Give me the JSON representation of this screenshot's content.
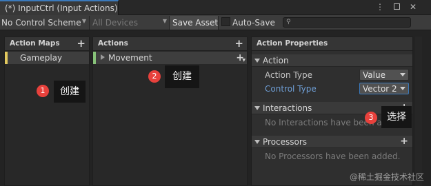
{
  "window": {
    "tab_title": "(*) InputCtrl (Input Actions)",
    "menu_icon": "⋮",
    "close_icon": "✕"
  },
  "toolbar": {
    "control_scheme": "No Control Scheme",
    "devices": "All Devices",
    "save_asset": "Save Asset",
    "auto_save": "Auto-Save",
    "auto_save_checked": false
  },
  "panes": {
    "action_maps": {
      "header": "Action Maps",
      "items": [
        {
          "label": "Gameplay",
          "color": "#e2c95e"
        }
      ]
    },
    "actions": {
      "header": "Actions",
      "items": [
        {
          "label": "Movement",
          "color": "#87c279"
        }
      ]
    },
    "properties": {
      "header": "Action Properties",
      "action_section": "Action",
      "action_type_label": "Action Type",
      "action_type_value": "Value",
      "control_type_label": "Control Type",
      "control_type_value": "Vector 2",
      "interactions_section": "Interactions",
      "interactions_empty": "No Interactions have been added.",
      "processors_section": "Processors",
      "processors_empty": "No Processors have been added."
    }
  },
  "annotations": [
    {
      "num": "1",
      "text": "创建"
    },
    {
      "num": "2",
      "text": "创建"
    },
    {
      "num": "3",
      "text": "选择"
    }
  ],
  "watermark": "@稀土掘金技术社区",
  "colors": {
    "accent_blue": "#3a79bb",
    "badge_red": "#e8413c",
    "link_blue": "#6f9fd6"
  }
}
